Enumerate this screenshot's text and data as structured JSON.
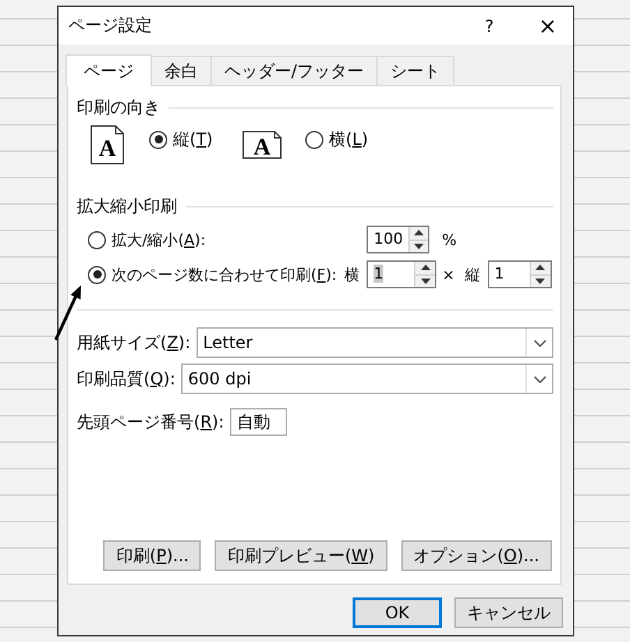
{
  "window": {
    "title": "ページ設定",
    "help_button": "?",
    "close_button": "×"
  },
  "tabs": [
    {
      "label": "ページ",
      "selected": true
    },
    {
      "label": "余白",
      "selected": false
    },
    {
      "label": "ヘッダー/フッター",
      "selected": false
    },
    {
      "label": "シート",
      "selected": false
    }
  ],
  "orientation": {
    "heading": "印刷の向き",
    "options": [
      {
        "kind": "portrait",
        "icon_text": "A",
        "label": "縦(T)",
        "selected": true
      },
      {
        "kind": "landscape",
        "icon_text": "A",
        "label": "横(L)",
        "selected": false
      }
    ]
  },
  "scaling": {
    "heading": "拡大縮小印刷",
    "options": [
      {
        "kind": "percent",
        "label": "拡大/縮小(A):",
        "selected": false,
        "value": "100",
        "unit": "%"
      },
      {
        "kind": "fit",
        "label": "次のページ数に合わせて印刷(F):",
        "selected": true,
        "wide_label": "横",
        "wide_value": "1",
        "wide_value_highlighted": true,
        "times": "×",
        "tall_label": "縦",
        "tall_value": "1"
      }
    ]
  },
  "paper_size": {
    "label": "用紙サイズ(Z):",
    "value": "Letter"
  },
  "print_quality": {
    "label": "印刷品質(Q):",
    "value": "600 dpi"
  },
  "first_page_number": {
    "label": "先頭ページ番号(R):",
    "value": "自動"
  },
  "actions": [
    {
      "label": "印刷(P)..."
    },
    {
      "label": "印刷プレビュー(W)"
    },
    {
      "label": "オプション(O)..."
    }
  ],
  "buttons": [
    {
      "label": "OK",
      "default": true
    },
    {
      "label": "キャンセル",
      "default": false
    }
  ]
}
